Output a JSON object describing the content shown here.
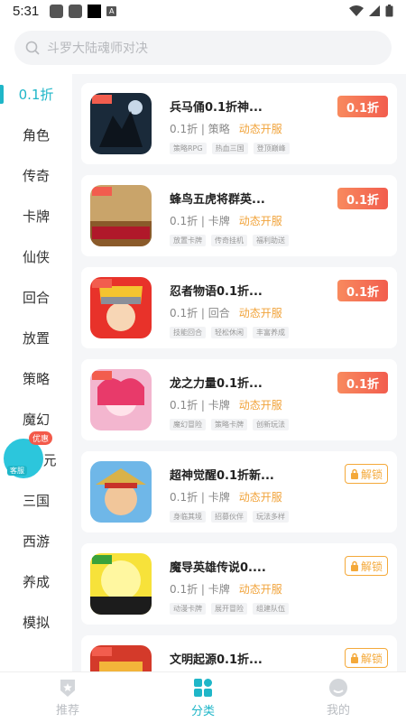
{
  "status": {
    "time": "5:31"
  },
  "search": {
    "placeholder": "斗罗大陆魂师对决"
  },
  "sidebar": {
    "items": [
      "0.1折",
      "角色",
      "传奇",
      "卡牌",
      "仙侠",
      "回合",
      "放置",
      "策略",
      "魔幻",
      "二次元",
      "三国",
      "西游",
      "养成",
      "模拟"
    ]
  },
  "float_badge": {
    "label": "优惠",
    "sub": "客服"
  },
  "games": [
    {
      "title": "兵马俑0.1折神...",
      "discount": "0.1折",
      "category": "策略",
      "status": "动态开服",
      "tags": [
        "策略RPG",
        "热血三国",
        "登顶巅峰"
      ],
      "action": "0.1折"
    },
    {
      "title": "蜂鸟五虎将群英...",
      "discount": "0.1折",
      "category": "卡牌",
      "status": "动态开服",
      "tags": [
        "放置卡牌",
        "传奇挂机",
        "福利助送"
      ],
      "action": "0.1折"
    },
    {
      "title": "忍者物语0.1折...",
      "discount": "0.1折",
      "category": "回合",
      "status": "动态开服",
      "tags": [
        "技能回合",
        "轻松休闲",
        "丰富养成"
      ],
      "action": "0.1折"
    },
    {
      "title": "龙之力量0.1折...",
      "discount": "0.1折",
      "category": "卡牌",
      "status": "动态开服",
      "tags": [
        "魔幻冒险",
        "策略卡牌",
        "创新玩法"
      ],
      "action": "0.1折"
    },
    {
      "title": "超神觉醒0.1折新...",
      "discount": "0.1折",
      "category": "卡牌",
      "status": "动态开服",
      "tags": [
        "身临其境",
        "招募伙伴",
        "玩法多样"
      ],
      "action": "解锁"
    },
    {
      "title": "魔导英雄传说0....",
      "discount": "0.1折",
      "category": "卡牌",
      "status": "动态开服",
      "tags": [
        "动漫卡牌",
        "展开冒险",
        "组建队伍"
      ],
      "action": "解锁"
    },
    {
      "title": "文明起源0.1折...",
      "discount": "0.1折",
      "category": "",
      "status": "",
      "tags": [],
      "action": "解锁"
    }
  ],
  "bottom_nav": [
    "推荐",
    "分类",
    "我的"
  ],
  "colors": {
    "accent": "#1fb6c8",
    "discount_btn": "#f25d4e",
    "unlock": "#f4a93a",
    "hot_text": "#f1a33a"
  }
}
